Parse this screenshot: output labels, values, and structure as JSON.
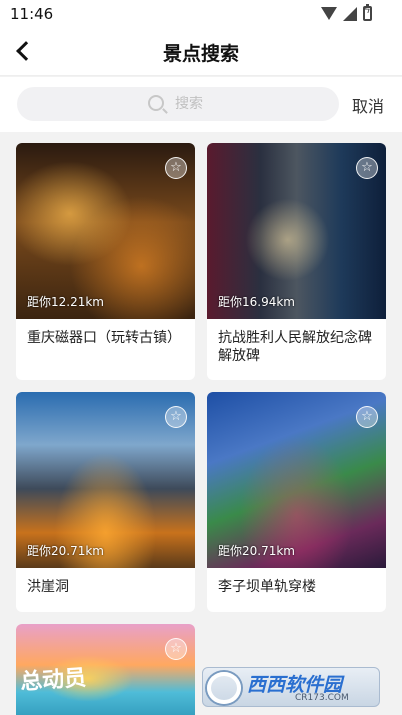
{
  "status_bar": {
    "time": "11:46"
  },
  "header": {
    "title": "景点搜索"
  },
  "search": {
    "placeholder": "搜索",
    "cancel_label": "取消"
  },
  "spots": [
    {
      "distance": "距你12.21km",
      "name": "重庆磁器口（玩转古镇）"
    },
    {
      "distance": "距你16.94km",
      "name": "抗战胜利人民解放纪念碑解放碑"
    },
    {
      "distance": "距你20.71km",
      "name": "洪崖洞"
    },
    {
      "distance": "距你20.71km",
      "name": "李子坝单轨穿楼"
    },
    {
      "image_text": "总动员"
    }
  ],
  "watermark": {
    "brand": "西西软件园",
    "url": "CR173.COM"
  }
}
